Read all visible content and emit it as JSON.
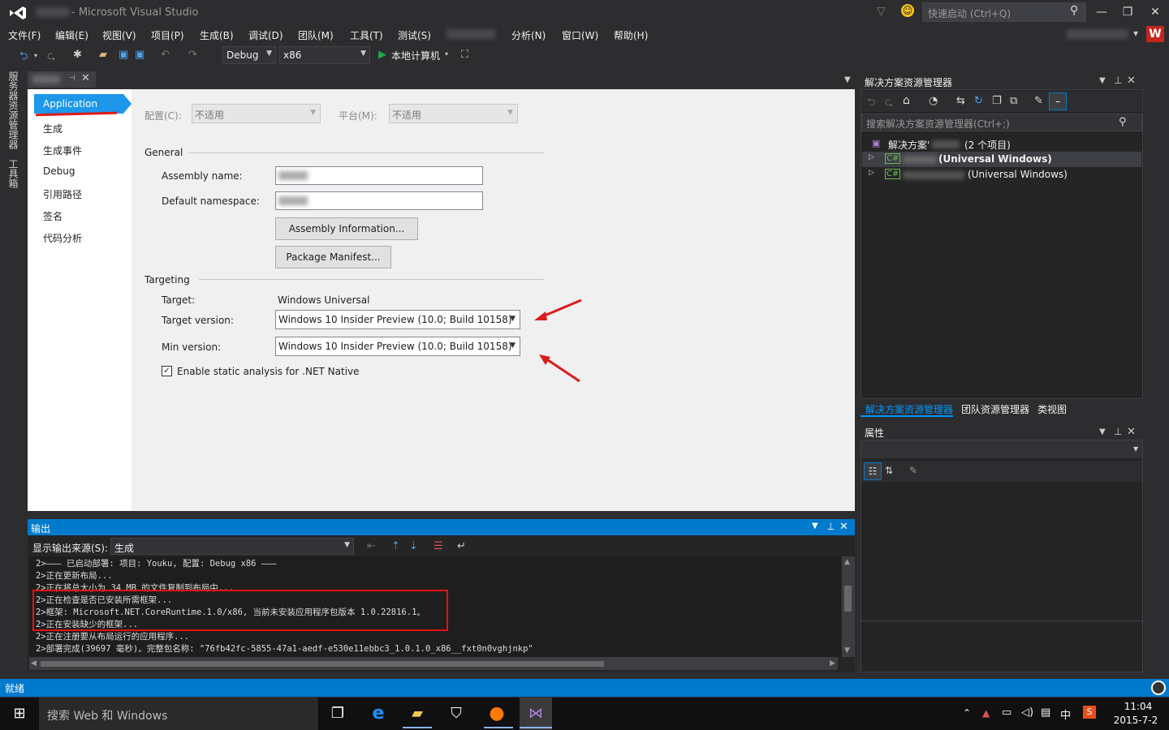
{
  "window": {
    "title": "- Microsoft Visual Studio",
    "quick_launch": "快速启动 (Ctrl+Q)",
    "avatar_letter": "W"
  },
  "menu": [
    "文件(F)",
    "编辑(E)",
    "视图(V)",
    "项目(P)",
    "生成(B)",
    "调试(D)",
    "团队(M)",
    "工具(T)",
    "测试(S)",
    "分析(N)",
    "窗口(W)",
    "帮助(H)"
  ],
  "toolbar": {
    "config": "Debug",
    "platform": "x86",
    "run_label": "本地计算机"
  },
  "left_tabs": [
    "服务器资源管理器",
    "工具箱"
  ],
  "nav": {
    "selected": "Application",
    "items": [
      "生成",
      "生成事件",
      "Debug",
      "引用路径",
      "签名",
      "代码分析"
    ]
  },
  "props": {
    "config_label": "配置(C):",
    "config_value": "不适用",
    "platform_label": "平台(M):",
    "platform_value": "不适用",
    "general": "General",
    "assembly_name": "Assembly name:",
    "default_namespace": "Default namespace:",
    "assembly_info_btn": "Assembly Information...",
    "package_manifest_btn": "Package Manifest...",
    "targeting": "Targeting",
    "target_label": "Target:",
    "target_value": "Windows Universal",
    "target_version_label": "Target version:",
    "target_version": "Windows 10 Insider Preview (10.0; Build 10158)",
    "min_version_label": "Min version:",
    "min_version": "Windows 10 Insider Preview (10.0; Build 10158)",
    "static_analysis": "Enable static analysis for .NET Native"
  },
  "output": {
    "title": "输出",
    "source_label": "显示输出来源(S):",
    "source": "生成",
    "lines": [
      "2>——— 已启动部署: 项目: Youku, 配置: Debug x86 ———",
      "2>正在更新布局...",
      "2>正在将总大小为 34 MB 的文件复制到布局中...",
      "2>正在检查是否已安装所需框架...",
      "2>框架: Microsoft.NET.CoreRuntime.1.0/x86, 当前未安装应用程序包版本 1.0.22816.1。",
      "2>正在安装缺少的框架...",
      "2>正在注册要从布局运行的应用程序...",
      "2>部署完成(39697 毫秒)。完整包名称: \"76fb42fc-5855-47a1-aedf-e530e11ebbc3_1.0.1.0_x86__fxt0n0vghjnkp\""
    ]
  },
  "solution_explorer": {
    "title": "解决方案资源管理器",
    "search": "搜索解决方案资源管理器(Ctrl+;)",
    "root_label": "解决方案'",
    "root_count": "(2 个项目)",
    "project1": "(Universal Windows)",
    "project2": "(Universal Windows)",
    "tabs": [
      "解决方案资源管理器",
      "团队资源管理器",
      "类视图"
    ]
  },
  "properties": {
    "title": "属性"
  },
  "status": {
    "text": "就绪"
  },
  "taskbar": {
    "search": "搜索 Web 和 Windows",
    "time": "11:04",
    "date": "2015-7-2",
    "ime": "中"
  }
}
